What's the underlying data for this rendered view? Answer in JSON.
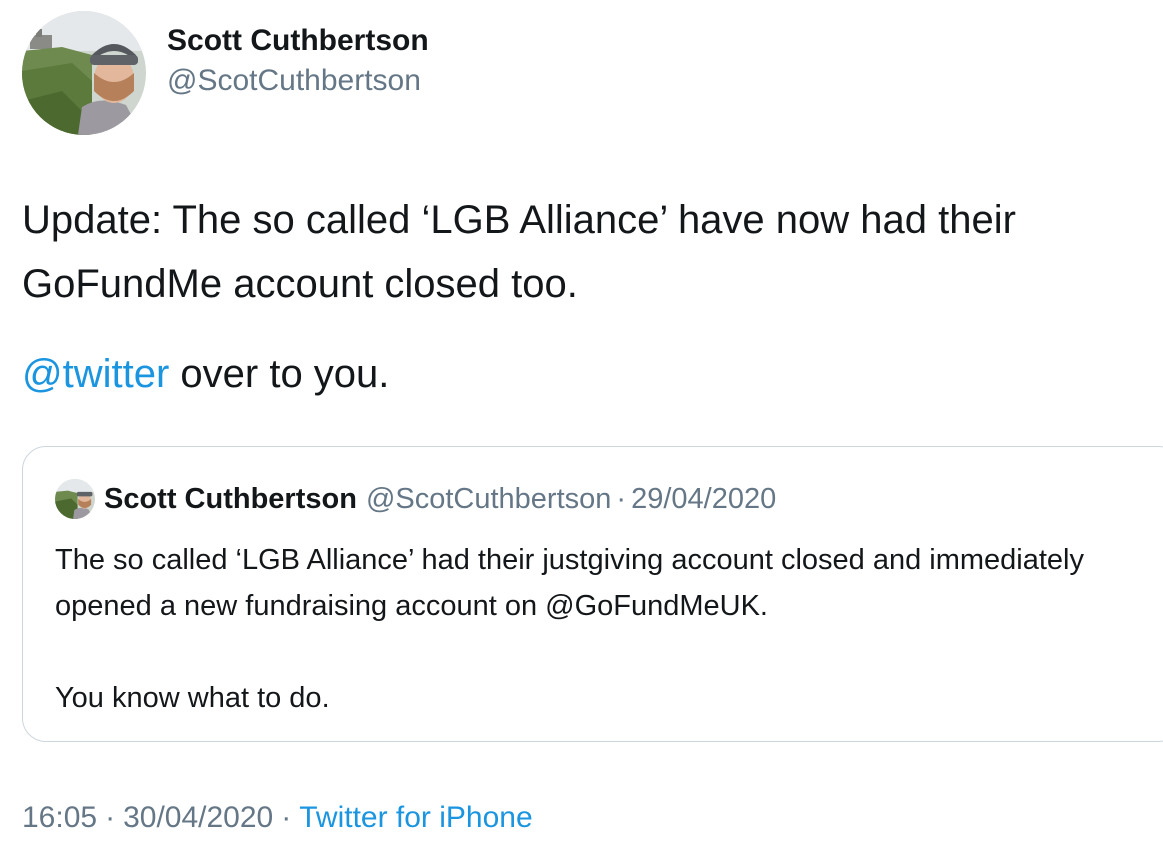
{
  "author": {
    "display_name": "Scott Cuthbertson",
    "handle": "@ScotCuthbertson"
  },
  "tweet": {
    "paragraph1": "Update: The so called ‘LGB Alliance’ have now had their GoFundMe account closed too.",
    "paragraph2_mention": "@twitter",
    "paragraph2_rest": " over to you."
  },
  "quoted_tweet": {
    "display_name": "Scott Cuthbertson",
    "handle": "@ScotCuthbertson",
    "separator": "·",
    "date": "29/04/2020",
    "paragraph1": "The so called ‘LGB Alliance’ had their justgiving account closed and immediately opened a new fundraising account on @GoFundMeUK.",
    "paragraph2": "You know what to do."
  },
  "meta": {
    "time": "16:05",
    "date": "30/04/2020",
    "separator": "·",
    "source": "Twitter for iPhone"
  },
  "colors": {
    "link": "#1b95e0",
    "secondary_text": "#657786",
    "border": "#ccd6dd"
  }
}
